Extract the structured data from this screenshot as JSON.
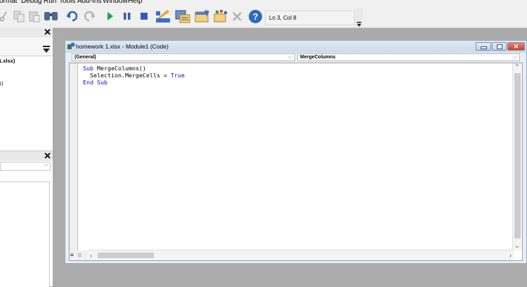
{
  "menu": [
    "ormat",
    "Debug",
    "Run",
    "Tools",
    "Add-Ins",
    "Window",
    "Help"
  ],
  "toolbar": {
    "icons": [
      "cut-icon",
      "copy-icon",
      "paste-icon",
      "find-icon",
      "undo-icon",
      "redo-icon",
      "run-icon",
      "break-icon",
      "reset-icon",
      "design-mode-icon",
      "project-explorer-icon",
      "properties-icon",
      "object-browser-icon",
      "toolbox-icon",
      "help-icon"
    ],
    "cursor_position": "Ln 3, Col 8"
  },
  "project_pane": {
    "item": "1.xlsx)",
    "item2": "1)"
  },
  "code_window": {
    "title": "homework 1.xlsx - Module1 (Code)",
    "object_combo": "(General)",
    "procedure_combo": "MergeColumns",
    "code_lines": [
      "Sub MergeColumns()",
      "  Selection.MergeCells = True",
      "End Sub"
    ]
  },
  "colors": {
    "keyword": "#0a0ad0",
    "run_green": "#1aa64a",
    "workspace": "#ababab"
  }
}
